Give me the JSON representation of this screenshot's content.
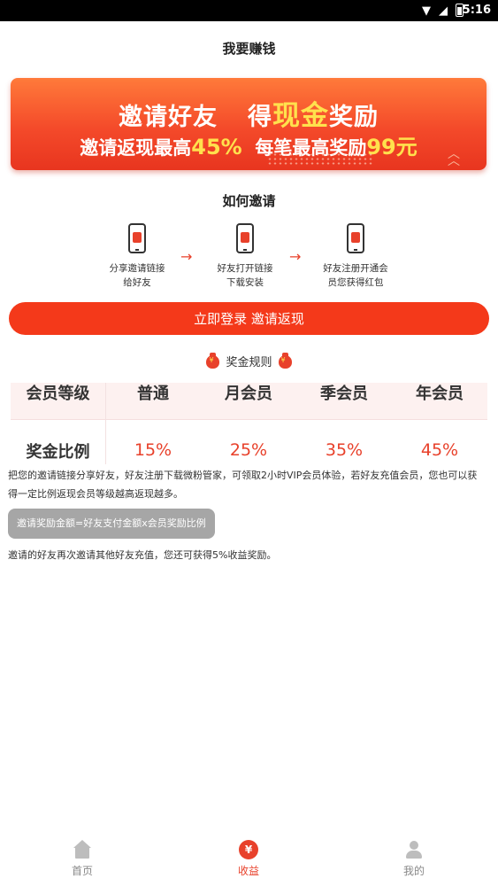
{
  "status_bar": {
    "time": "5:16"
  },
  "page": {
    "title": "我要赚钱"
  },
  "banner": {
    "line1_pre": "邀请好友",
    "line1_mid": "得",
    "line1_highlight": "现金",
    "line1_post": "奖励",
    "line2_pre": "邀请返现最高",
    "line2_pct1": "45%",
    "line2_mid": "每笔最高奖励",
    "line2_pct2": "99元"
  },
  "how_to": {
    "title": "如何邀请",
    "steps": [
      {
        "line1": "分享邀请链接",
        "line2": "给好友",
        "icon": "share-phone-icon"
      },
      {
        "line1": "好友打开链接",
        "line2": "下载安装",
        "icon": "download-phone-icon"
      },
      {
        "line1": "好友注册开通会",
        "line2": "员您获得红包",
        "icon": "redpacket-phone-icon"
      }
    ],
    "arrow": "→"
  },
  "cta": {
    "label": "立即登录 邀请返现"
  },
  "rules": {
    "title": "奖金规则",
    "table": {
      "row1_header": "会员等级",
      "levels": [
        "普通",
        "月会员",
        "季会员",
        "年会员"
      ],
      "row2_header": "奖金比例",
      "rates": [
        "15%",
        "25%",
        "35%",
        "45%"
      ]
    },
    "para1_line1": "把您的邀请链接分享好友，好友注册下载微粉管家，可领取2小时VIP会员体验，若好友充值会员，您也可以获",
    "para1_line2": "得一定比例返现会员等级越高返现越多。",
    "formula": "邀请奖励金额=好友支付金额x会员奖励比例",
    "para2": "邀请的好友再次邀请其他好友充值，您还可获得5%收益奖励。"
  },
  "tabbar": {
    "tabs": [
      {
        "label": "首页",
        "icon": "home-icon",
        "active": false
      },
      {
        "label": "收益",
        "icon": "yen-icon",
        "active": true
      },
      {
        "label": "我的",
        "icon": "user-icon",
        "active": false
      }
    ],
    "yen_symbol": "¥"
  },
  "colors": {
    "accent": "#f4391a",
    "highlight": "#ffe14d",
    "pill": "#a6a6a6"
  }
}
